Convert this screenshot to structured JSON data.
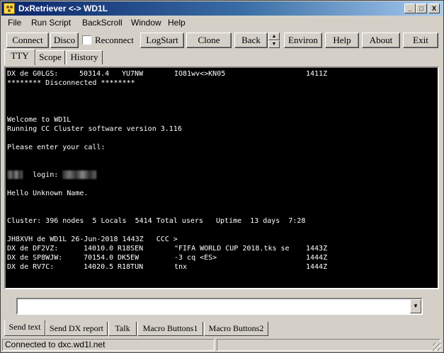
{
  "window": {
    "title": "DxRetriever <-> WD1L"
  },
  "titlebar_buttons": [
    "_",
    "□",
    "X"
  ],
  "menu": [
    "File",
    "Run Script",
    "BackScroll",
    "Window",
    "Help"
  ],
  "toolbar": {
    "connect": "Connect",
    "disco": "Disco",
    "reconnect": "Reconnect",
    "reconnect_checked": false,
    "logstart": "LogStart",
    "clone": "Clone",
    "back": "Back",
    "environ": "Environ",
    "help": "Help",
    "about": "About",
    "exit": "Exit"
  },
  "top_tabs": [
    "TTY",
    "Scope",
    "History"
  ],
  "active_top_tab": "TTY",
  "terminal": {
    "background": "#000000",
    "foreground": "#ffffff",
    "lines": [
      [
        "DX de G0LGS:",
        "50314.4",
        "YU7NW",
        "IO81wv<>KN05",
        "1411Z"
      ],
      [
        "******** Disconnected ********"
      ],
      [
        ""
      ],
      [
        ""
      ],
      [
        ""
      ],
      [
        "Welcome to WD1L"
      ],
      [
        "Running CC Cluster software version 3.116"
      ],
      [
        ""
      ],
      [
        "Please enter your call:"
      ],
      [
        ""
      ],
      [
        "login: "
      ],
      [
        ""
      ],
      [
        ""
      ],
      [
        "Hello Unknown Name."
      ],
      [
        ""
      ],
      [
        ""
      ],
      [
        "Cluster: 396 nodes  5 Locals  5414 Total users   Uptime  13 days  7:28"
      ],
      [
        ""
      ],
      [
        "JH8XVH de WD1L 26-Jun-2018 1443Z   CCC >"
      ],
      [
        "DX de DF2VZ:",
        "14010.0",
        "R18SEN",
        "\"FIFA WORLD CUP 2018.tks se",
        "1443Z"
      ],
      [
        "DX de SP8WJW:",
        "70154.0",
        "DK5EW",
        "-3 cq <ES>",
        "1444Z"
      ],
      [
        "DX de RV7C:",
        "14020.5",
        "R18TUN",
        "tnx",
        "1444Z"
      ]
    ]
  },
  "input": {
    "value": "",
    "placeholder": ""
  },
  "bottom_tabs": [
    "Send text",
    "Send DX report",
    "Talk",
    "Macro Buttons1",
    "Macro Buttons2"
  ],
  "active_bottom_tab": "Send text",
  "status": {
    "text": "Connected to dxc.wd1l.net"
  }
}
